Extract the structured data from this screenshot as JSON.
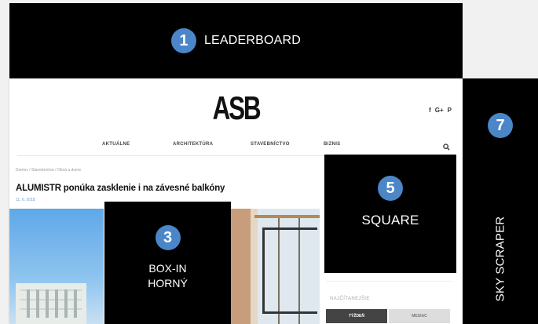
{
  "leaderboard": {
    "number": "1",
    "label": "LEADERBOARD"
  },
  "site": {
    "logo": "ASB",
    "social": [
      "f",
      "G+",
      "P"
    ],
    "nav": [
      "AKTUÁLNE",
      "ARCHITEKTÚRA",
      "STAVEBNÍCTVO",
      "BIZNIS"
    ],
    "search_icon": "search-icon",
    "breadcrumb": "Domov / Stavebníctvo / Okná a dvere",
    "headline": "ALUMISTR ponúka zasklenie i na závesné balkóny",
    "date": "11. 6. 2018",
    "sidebar_title": "NAJČÍTANEJŠIE",
    "tabs": [
      "TÝŽDEŇ",
      "MESIAC"
    ]
  },
  "box_in": {
    "number": "3",
    "label_line1": "BOX-IN",
    "label_line2": "HORNÝ"
  },
  "square": {
    "number": "5",
    "label": "SQUARE"
  },
  "skyscraper": {
    "number": "7",
    "label": "SKY SCRAPER"
  },
  "colors": {
    "badge": "#4a86c8",
    "ad_background": "#000000"
  }
}
